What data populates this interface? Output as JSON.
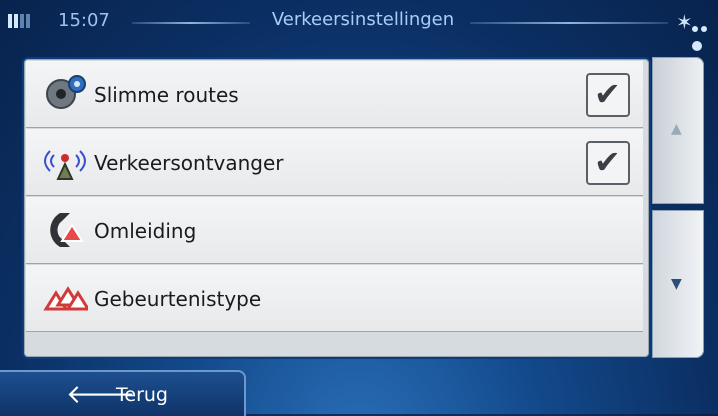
{
  "status_bar": {
    "time": "15:07",
    "title": "Verkeersinstellingen",
    "signal_icon": "satellite-icon"
  },
  "settings": {
    "items": [
      {
        "label": "Slimme routes",
        "icon": "gears-icon",
        "checked": true
      },
      {
        "label": "Verkeersontvanger",
        "icon": "traffic-receiver-icon",
        "checked": true
      },
      {
        "label": "Omleiding",
        "icon": "detour-icon",
        "checked": null
      },
      {
        "label": "Gebeurtenistype",
        "icon": "event-type-icon",
        "checked": null
      }
    ]
  },
  "scrollbar": {
    "up_icon": "arrow-up-icon",
    "down_icon": "arrow-down-icon"
  },
  "footer": {
    "back_label": "Terug",
    "back_icon": "arrow-left-icon"
  },
  "colors": {
    "background": "#0b2f63",
    "accent": "#9cc3ee",
    "row": "#eef0f2"
  }
}
